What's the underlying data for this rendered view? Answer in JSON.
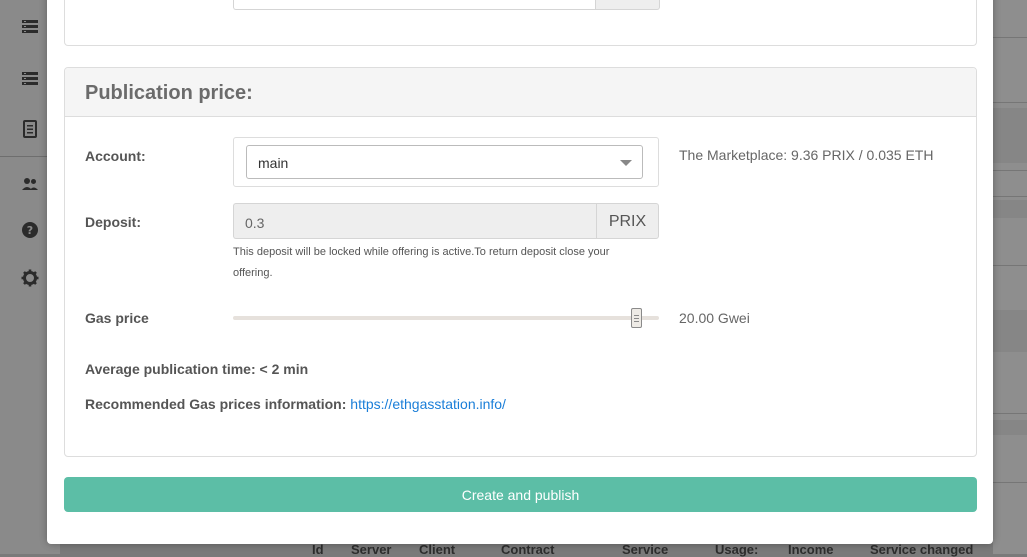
{
  "panel": {
    "title": "Publication price:"
  },
  "account": {
    "label": "Account:",
    "selected": "main"
  },
  "marketplace_info": "The Marketplace: 9.36 PRIX / 0.035 ETH",
  "deposit": {
    "label": "Deposit:",
    "value": "0.3",
    "unit": "PRIX",
    "help": "This deposit will be locked while offering is active.To return deposit close your offering."
  },
  "gas": {
    "label": "Gas price",
    "value_label": "20.00 Gwei",
    "slider_fraction": 0.96
  },
  "average_time": "Average publication time: < 2 min",
  "recommended": {
    "label": "Recommended Gas prices information: ",
    "link_text": "https://ethgasstation.info/"
  },
  "create_button": "Create and publish",
  "background_table": {
    "columns": [
      "Id",
      "Server",
      "Client",
      "Contract",
      "Service",
      "Usage:",
      "Income",
      "Service changed"
    ]
  },
  "colors": {
    "primary_button": "#5cbea6",
    "link": "#1a7ed8",
    "overlay": "#7a7a7a"
  }
}
